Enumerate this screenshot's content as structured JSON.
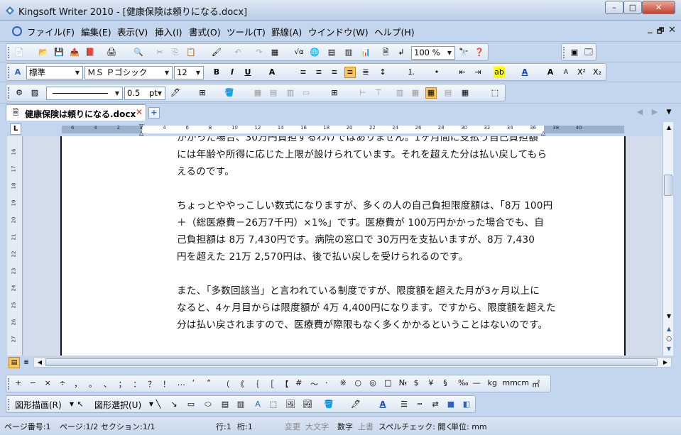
{
  "window": {
    "title": "Kingsoft Writer 2010 - [健康保険は頼りになる.docx]",
    "min": "–",
    "max": "□",
    "close": "✕"
  },
  "menu": {
    "items": [
      "ファイル(F)",
      "編集(E)",
      "表示(V)",
      "挿入(I)",
      "書式(O)",
      "ツール(T)",
      "罫線(A)",
      "ウインドウ(W)",
      "ヘルプ(H)"
    ],
    "mdi_min": "_",
    "mdi_restore": "🗗",
    "mdi_close": "✕"
  },
  "standard": {
    "zoom": "100 %"
  },
  "format": {
    "style": "標準",
    "font": "ＭＳ Ｐゴシック",
    "size": "12"
  },
  "drawing_format": {
    "line_width": "0.5",
    "line_unit": "pt"
  },
  "tab": {
    "label": "健康保険は頼りになる.docx"
  },
  "ruler": {
    "top": [
      "6",
      "4",
      "2",
      "2",
      "4",
      "6",
      "8",
      "10",
      "12",
      "14",
      "16",
      "18",
      "20",
      "22",
      "24",
      "26",
      "28",
      "30",
      "32",
      "34",
      "36",
      "38",
      "40"
    ],
    "side": [
      "16",
      "17",
      "18",
      "19",
      "20",
      "21",
      "22",
      "23",
      "24",
      "25",
      "26",
      "27"
    ]
  },
  "document": {
    "para1": [
      "かかった場合、30万円負担するわけではありません。1ヶ月間に支払う自己負担額",
      "には年齢や所得に応じた上限が設けられています。それを超えた分は払い戻してもら",
      "えるのです。"
    ],
    "para2": [
      "ちょっとややっこしい数式になりますが、多くの人の自己負担限度額は、「8万 100円",
      "＋（総医療費－26万7千円）×1%」です。医療費が 100万円かかった場合でも、自",
      "己負担額は 8万 7,430円です。病院の窓口で 30万円を支払いますが、8万 7,430",
      "円を超えた 21万 2,570円は、後で払い戻しを受けられるのです。"
    ],
    "para3": [
      "また、「多数回該当」と言われている制度ですが、限度額を超えた月が3ヶ月以上に",
      "なると、4ヶ月目からは限度額が 4万 4,400円になります。ですから、限度額を超えた",
      "分は払い戻されますので、医療費が際限もなく多くかかるということはないのです。"
    ]
  },
  "symbols": [
    "+",
    "−",
    "×",
    "÷",
    "，",
    "。",
    "、",
    "；",
    "：",
    "？",
    "！",
    "…",
    "‘",
    "“",
    "（",
    "《",
    "｛",
    "［",
    "【",
    "#",
    "～",
    "·",
    "※",
    "○",
    "◎",
    "□",
    "№",
    "$",
    "¥",
    "§",
    "‰",
    "—",
    "kg",
    "mm",
    "cm",
    "㎡"
  ],
  "draw": {
    "shape_label": "図形描画(R)",
    "select_label": "図形選択(U)"
  },
  "status": {
    "page_no": "ページ番号:1",
    "pages": "ページ:1/2",
    "section": "セクション:1/1",
    "line": "行:1",
    "col": "桁:1",
    "change": "変更",
    "caps": "大文字",
    "num": "数字",
    "overwrite": "上書",
    "spell": "スペルチェック: 開く",
    "unit": "単位: mm"
  }
}
